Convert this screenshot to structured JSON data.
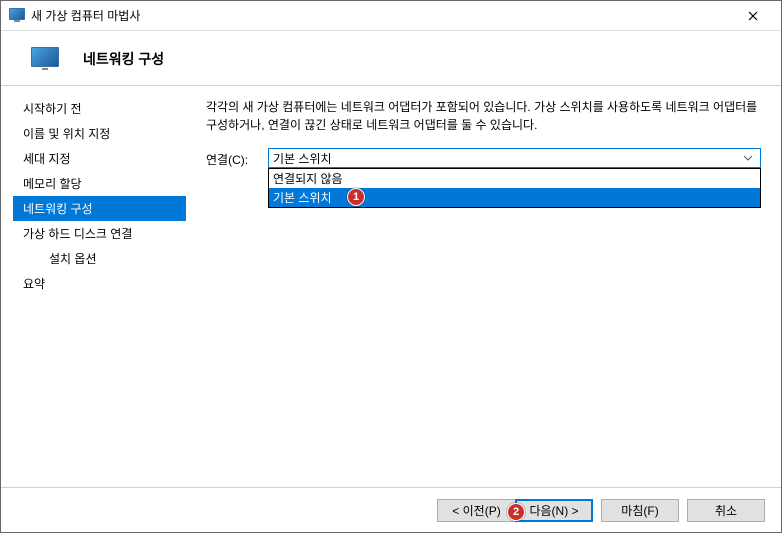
{
  "window": {
    "title": "새 가상 컴퓨터 마법사"
  },
  "header": {
    "title": "네트워킹 구성"
  },
  "sidebar": {
    "items": [
      {
        "label": "시작하기 전"
      },
      {
        "label": "이름 및 위치 지정"
      },
      {
        "label": "세대 지정"
      },
      {
        "label": "메모리 할당"
      },
      {
        "label": "네트워킹 구성",
        "selected": true
      },
      {
        "label": "가상 하드 디스크 연결"
      },
      {
        "label": "설치 옵션",
        "indent": true
      },
      {
        "label": "요약"
      }
    ]
  },
  "content": {
    "description": "각각의 새 가상 컴퓨터에는 네트워크 어댑터가 포함되어 있습니다. 가상 스위치를 사용하도록 네트워크 어댑터를 구성하거나, 연결이 끊긴 상태로 네트워크 어댑터를 둘 수 있습니다.",
    "connection_label": "연결(C):",
    "selected_value": "기본 스위치",
    "options": [
      {
        "label": "연결되지 않음"
      },
      {
        "label": "기본 스위치",
        "selected": true
      }
    ]
  },
  "callouts": {
    "one": "1",
    "two": "2"
  },
  "footer": {
    "prev": "< 이전(P)",
    "next": "다음(N) >",
    "finish": "마침(F)",
    "cancel": "취소"
  }
}
